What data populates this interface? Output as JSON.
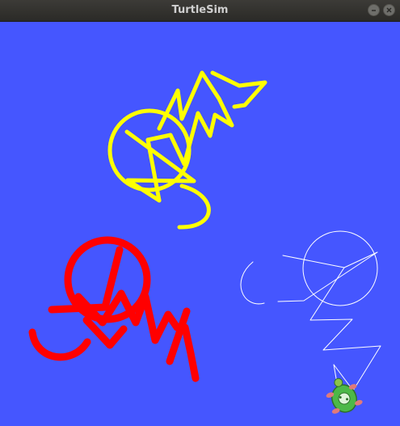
{
  "window": {
    "title": "TurtleSim",
    "background_color": "#4556FF"
  },
  "controls": {
    "minimize_icon": "minimize-icon",
    "close_icon": "close-icon"
  },
  "drawings": [
    {
      "name": "yellow-trail",
      "color": "#FFFF00"
    },
    {
      "name": "red-trail",
      "color": "#FF0000"
    },
    {
      "name": "white-trail",
      "color": "#FFFFFF"
    }
  ],
  "turtle": {
    "icon": "turtle-icon",
    "shell_color": "#4DB848"
  }
}
